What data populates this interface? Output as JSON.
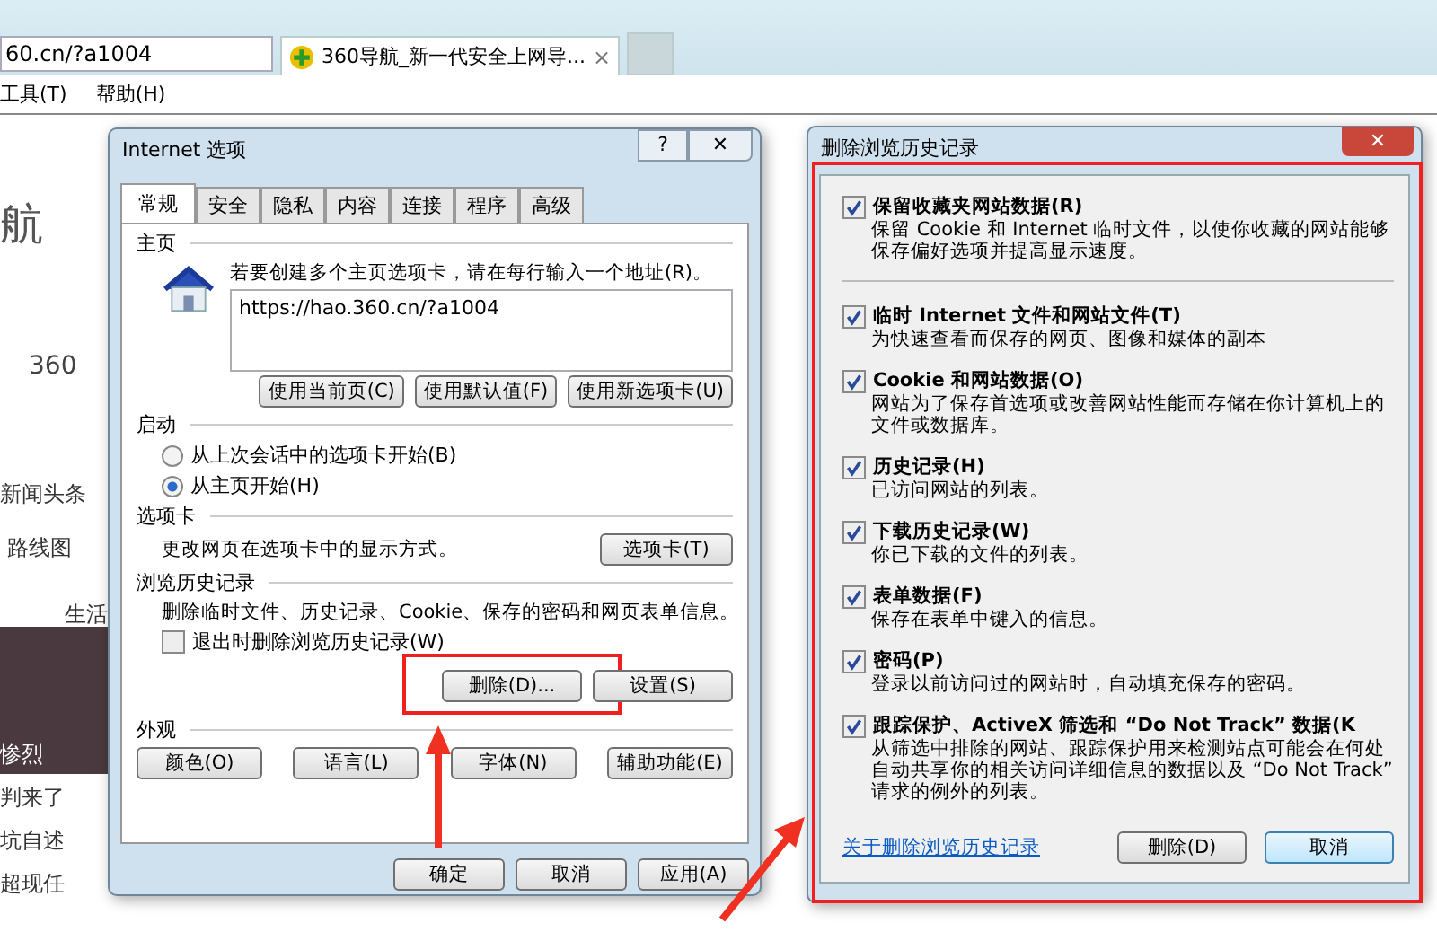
{
  "browser": {
    "address": "60.cn/?a1004",
    "tab_title": "360导航_新一代安全上网导...",
    "tab_close": "×",
    "menu": [
      "工具(T)",
      "帮助(H)"
    ],
    "page_fragments": [
      "航",
      "360",
      "新闻头条",
      "路线图",
      "生活",
      "惨烈",
      "判来了",
      "坑自述",
      "超现任"
    ]
  },
  "options_dialog": {
    "title": "Internet 选项",
    "help": "?",
    "close": "✕",
    "tabs": [
      {
        "label": "常规",
        "selected": true
      },
      {
        "label": "安全",
        "selected": false
      },
      {
        "label": "隐私",
        "selected": false
      },
      {
        "label": "内容",
        "selected": false
      },
      {
        "label": "连接",
        "selected": false
      },
      {
        "label": "程序",
        "selected": false
      },
      {
        "label": "高级",
        "selected": false
      }
    ],
    "homepage": {
      "heading": "主页",
      "hint": "若要创建多个主页选项卡，请在每行输入一个地址(R)。",
      "value": "https://hao.360.cn/?a1004",
      "buttons": [
        "使用当前页(C)",
        "使用默认值(F)",
        "使用新选项卡(U)"
      ]
    },
    "startup": {
      "heading": "启动",
      "options": [
        {
          "label": "从上次会话中的选项卡开始(B)",
          "selected": false
        },
        {
          "label": "从主页开始(H)",
          "selected": true
        }
      ]
    },
    "tabs_section": {
      "heading": "选项卡",
      "text": "更改网页在选项卡中的显示方式。",
      "button": "选项卡(T)"
    },
    "history": {
      "heading": "浏览历史记录",
      "text": "删除临时文件、历史记录、Cookie、保存的密码和网页表单信息。",
      "checkbox": {
        "label": "退出时删除浏览历史记录(W)",
        "checked": false
      },
      "buttons": [
        "删除(D)...",
        "设置(S)"
      ]
    },
    "appearance": {
      "heading": "外观",
      "buttons": [
        "颜色(O)",
        "语言(L)",
        "字体(N)",
        "辅助功能(E)"
      ]
    },
    "footer_buttons": [
      "确定",
      "取消",
      "应用(A)"
    ]
  },
  "delete_dialog": {
    "title": "删除浏览历史记录",
    "close": "✕",
    "items": [
      {
        "label": "保留收藏夹网站数据(R)",
        "description": "保留 Cookie 和 Internet 临时文件，以使你收藏的网站能够保存偏好选项并提高显示速度。",
        "checked": true
      },
      {
        "label": "临时 Internet 文件和网站文件(T)",
        "description": "为快速查看而保存的网页、图像和媒体的副本",
        "checked": true
      },
      {
        "label": "Cookie 和网站数据(O)",
        "description": "网站为了保存首选项或改善网站性能而存储在你计算机上的文件或数据库。",
        "checked": true
      },
      {
        "label": "历史记录(H)",
        "description": "已访问网站的列表。",
        "checked": true
      },
      {
        "label": "下载历史记录(W)",
        "description": "你已下载的文件的列表。",
        "checked": true
      },
      {
        "label": "表单数据(F)",
        "description": "保存在表单中键入的信息。",
        "checked": true
      },
      {
        "label": "密码(P)",
        "description": "登录以前访问过的网站时，自动填充保存的密码。",
        "checked": true
      },
      {
        "label": "跟踪保护、ActiveX 筛选和 “Do Not Track” 数据(K",
        "description": "从筛选中排除的网站、跟踪保护用来检测站点可能会在何处自动共享你的相关访问详细信息的数据以及 “Do Not Track” 请求的例外的列表。",
        "checked": true
      }
    ],
    "link": "关于删除浏览历史记录",
    "buttons": [
      "删除(D)",
      "取消"
    ]
  }
}
